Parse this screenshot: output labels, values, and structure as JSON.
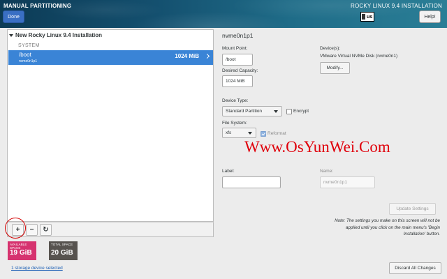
{
  "header": {
    "screen_title": "MANUAL PARTITIONING",
    "done_label": "Done",
    "product_title": "ROCKY LINUX 9.4 INSTALLATION",
    "keyboard_layout": "us",
    "help_label": "Help!"
  },
  "tree": {
    "root_label": "New Rocky Linux 9.4 Installation",
    "category": "SYSTEM",
    "partitions": [
      {
        "mount_point": "/boot",
        "device": "nvme0n1p1",
        "size": "1024 MiB",
        "selected": true
      }
    ]
  },
  "toolbar": {
    "add_label": "+",
    "remove_label": "−",
    "refresh_label": "↻"
  },
  "space": {
    "available_label": "AVAILABLE SPACE",
    "available_value": "19 GiB",
    "total_label": "TOTAL SPACE",
    "total_value": "20 GiB"
  },
  "storage_link": "1 storage device selected",
  "details": {
    "title": "nvme0n1p1",
    "mount_point_label": "Mount Point:",
    "mount_point_value": "/boot",
    "desired_capacity_label": "Desired Capacity:",
    "desired_capacity_value": "1024 MiB",
    "devices_label": "Device(s):",
    "devices_value": "VMware Virtual NVMe Disk (nvme0n1)",
    "modify_label": "Modify...",
    "device_type_label": "Device Type:",
    "device_type_value": "Standard Partition",
    "encrypt_label": "Encrypt",
    "encrypt_checked": false,
    "file_system_label": "File System:",
    "file_system_value": "xfs",
    "reformat_label": "Reformat",
    "reformat_checked": true,
    "label_label": "Label:",
    "label_value": "",
    "name_label": "Name:",
    "name_value": "nvme0n1p1",
    "update_settings_label": "Update Settings",
    "note_lead": "Note:",
    "note_text": "The settings you make on this screen will not be applied until you click on the main menu's 'Begin Installation' button.",
    "discard_label": "Discard All Changes"
  },
  "watermark": "Www.OsYunWei.Com",
  "colors": {
    "selection": "#3a84d6",
    "available": "#d6336f",
    "total": "#57534f",
    "watermark": "#e0000b",
    "circle": "#d40000"
  }
}
